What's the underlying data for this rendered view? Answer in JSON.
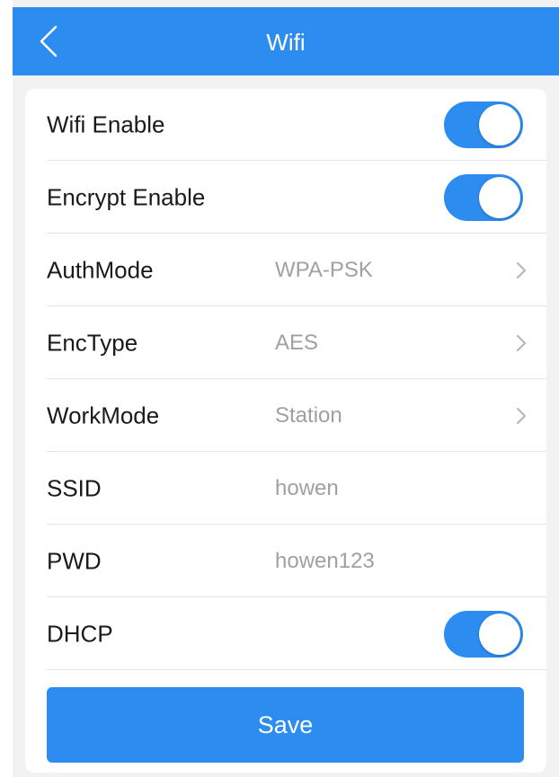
{
  "header": {
    "title": "Wifi",
    "back_icon": "chevron-left-icon"
  },
  "colors": {
    "accent": "#2d8cf0",
    "background": "#f2f2f2",
    "value_text": "#a0a0a0"
  },
  "settings": {
    "wifi_enable": {
      "label": "Wifi Enable",
      "on": true
    },
    "encrypt_enable": {
      "label": "Encrypt Enable",
      "on": true
    },
    "auth_mode": {
      "label": "AuthMode",
      "value": "WPA-PSK"
    },
    "enc_type": {
      "label": "EncType",
      "value": "AES"
    },
    "work_mode": {
      "label": "WorkMode",
      "value": "Station"
    },
    "ssid": {
      "label": "SSID",
      "value": "howen"
    },
    "pwd": {
      "label": "PWD",
      "value": "howen123"
    },
    "dhcp": {
      "label": "DHCP",
      "on": true
    }
  },
  "actions": {
    "save_label": "Save"
  }
}
